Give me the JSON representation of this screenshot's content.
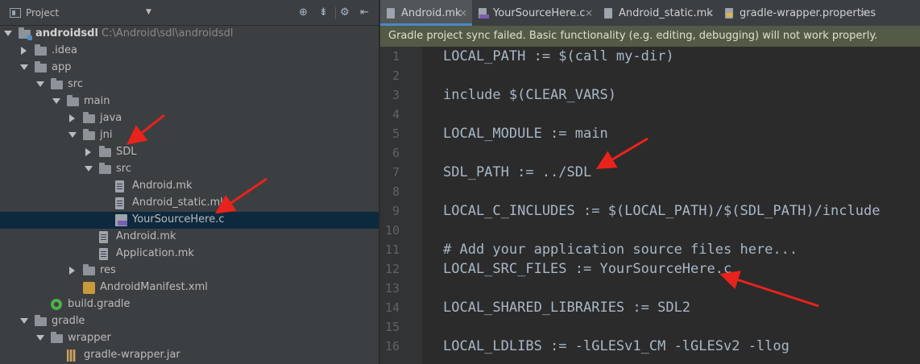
{
  "project_panel": {
    "title": "Project",
    "dropdown_icon": "triangle-down",
    "toolbar_icons": [
      "target-icon",
      "collapse-all-icon",
      "gear-icon",
      "hide-icon"
    ],
    "tree": [
      {
        "label": "androidsdl",
        "path": "C:\\Android\\sdl\\androidsdl",
        "depth": 0,
        "expanded": true,
        "icon": "module-folder-icon",
        "bold": true
      },
      {
        "label": ".idea",
        "depth": 1,
        "expanded": false,
        "icon": "folder-icon"
      },
      {
        "label": "app",
        "depth": 1,
        "expanded": true,
        "icon": "folder-icon"
      },
      {
        "label": "src",
        "depth": 2,
        "expanded": true,
        "icon": "folder-icon"
      },
      {
        "label": "main",
        "depth": 3,
        "expanded": true,
        "icon": "folder-icon"
      },
      {
        "label": "java",
        "depth": 4,
        "expanded": false,
        "icon": "folder-icon"
      },
      {
        "label": "jni",
        "depth": 4,
        "expanded": true,
        "icon": "folder-icon"
      },
      {
        "label": "SDL",
        "depth": 5,
        "expanded": false,
        "icon": "folder-icon"
      },
      {
        "label": "src",
        "depth": 5,
        "expanded": true,
        "icon": "folder-icon"
      },
      {
        "label": "Android.mk",
        "depth": 6,
        "icon": "text-file-icon"
      },
      {
        "label": "Android_static.mk",
        "depth": 6,
        "icon": "text-file-icon"
      },
      {
        "label": "YourSourceHere.c",
        "depth": 6,
        "icon": "c-file-icon",
        "selected": true
      },
      {
        "label": "Android.mk",
        "depth": 5,
        "icon": "text-file-icon"
      },
      {
        "label": "Application.mk",
        "depth": 5,
        "icon": "text-file-icon"
      },
      {
        "label": "res",
        "depth": 4,
        "expanded": false,
        "icon": "folder-icon"
      },
      {
        "label": "AndroidManifest.xml",
        "depth": 4,
        "icon": "xml-file-icon"
      },
      {
        "label": "build.gradle",
        "depth": 2,
        "icon": "gradle-file-icon"
      },
      {
        "label": "gradle",
        "depth": 1,
        "expanded": true,
        "icon": "folder-icon"
      },
      {
        "label": "wrapper",
        "depth": 2,
        "expanded": true,
        "icon": "folder-icon"
      },
      {
        "label": "gradle-wrapper.jar",
        "depth": 3,
        "icon": "jar-file-icon"
      }
    ]
  },
  "editor": {
    "tabs": [
      {
        "label": "Android.mk",
        "icon": "text-file-icon",
        "active": true
      },
      {
        "label": "YourSourceHere.c",
        "icon": "c-file-icon"
      },
      {
        "label": "Android_static.mk",
        "icon": "text-file-icon"
      },
      {
        "label": "gradle-wrapper.properties",
        "icon": "properties-file-icon"
      }
    ],
    "notice": "Gradle project sync failed. Basic functionality (e.g. editing, debugging) will not work properly.",
    "lines": [
      {
        "n": "1",
        "text": "LOCAL_PATH := $(call my-dir)"
      },
      {
        "n": "2",
        "text": ""
      },
      {
        "n": "3",
        "text": "include $(CLEAR_VARS)"
      },
      {
        "n": "4",
        "text": ""
      },
      {
        "n": "5",
        "text": "LOCAL_MODULE := main"
      },
      {
        "n": "6",
        "text": ""
      },
      {
        "n": "7",
        "text": "SDL_PATH := ../SDL"
      },
      {
        "n": "8",
        "text": ""
      },
      {
        "n": "9",
        "text": "LOCAL_C_INCLUDES := $(LOCAL_PATH)/$(SDL_PATH)/include"
      },
      {
        "n": "10",
        "text": ""
      },
      {
        "n": "11",
        "text": "# Add your application source files here..."
      },
      {
        "n": "12",
        "text": "LOCAL_SRC_FILES := YourSourceHere.c"
      },
      {
        "n": "13",
        "text": ""
      },
      {
        "n": "14",
        "text": "LOCAL_SHARED_LIBRARIES := SDL2"
      },
      {
        "n": "15",
        "text": ""
      },
      {
        "n": "16",
        "text": "LOCAL_LDLIBS := -lGLESv1_CM -lGLESv2 -llog"
      }
    ]
  },
  "colors": {
    "annotation_arrow": "#e8231b",
    "selection": "#0d293e",
    "notice_bg": "#535a45",
    "active_tab_underline": "#4a88c7"
  }
}
